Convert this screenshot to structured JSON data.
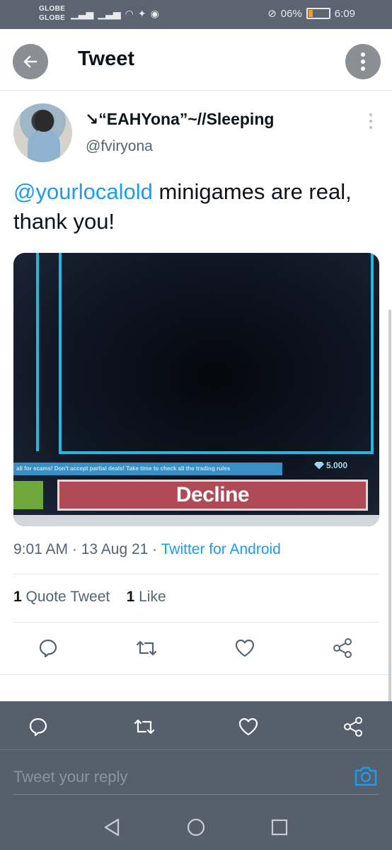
{
  "status_bar": {
    "carrier_1": "GLOBE",
    "carrier_2": "GLOBE",
    "battery": "06%",
    "time": "6:09"
  },
  "header": {
    "title": "Tweet",
    "back_icon": "arrow-left-icon",
    "more_icon": "more-vertical-icon"
  },
  "author": {
    "display_name": "↘“EAHYona”~//Sleeping",
    "handle": "@fviryona"
  },
  "tweet": {
    "mention": "@yourlocalold",
    "text": " minigames are real, thank you!"
  },
  "media": {
    "notice_text": "all for scams! Don't accept partial deals! Take time to check all the trading rules",
    "diamond_count": "5.000",
    "decline_label": "Decline"
  },
  "meta": {
    "time": "9:01 AM",
    "date": "13 Aug 21",
    "separator": " · ",
    "source": "Twitter for Android"
  },
  "stats": {
    "quote_count": "1",
    "quote_label": "Quote Tweet",
    "like_count": "1",
    "like_label": "Like"
  },
  "reply": {
    "placeholder": "Tweet your reply"
  },
  "colors": {
    "accent": "#1d9bf0",
    "text_secondary": "#536471",
    "overlay": "#55606c",
    "decline": "#b04a57"
  }
}
